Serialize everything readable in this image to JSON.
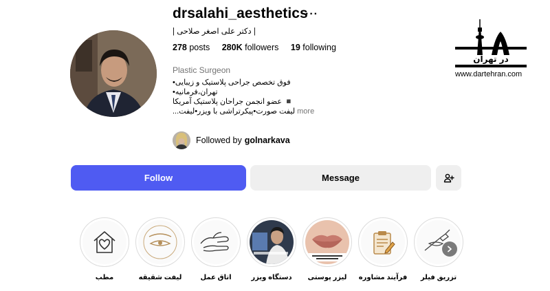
{
  "profile": {
    "username": "drsalahi_aesthetics",
    "more_icon": "more-horizontal-icon",
    "full_name": "| دکتر علی اصغر صلاحی |",
    "posts_count": "278",
    "posts_label": "posts",
    "followers_count": "280K",
    "followers_label": "followers",
    "following_count": "19",
    "following_label": "following",
    "category": "Plastic Surgeon",
    "bio_lines": [
      "فوق تخصص جراحی پلاستیک و زیبایی•",
      "تهران،فرمانیه•",
      "◾️ عضو انجمن جراحان پلاستیک آمریکا",
      "لیفت صورت•پیکرتراشی با ویزر•لیفت..."
    ],
    "bio_more": "more",
    "followed_by_prefix": "Followed by",
    "followed_by_user": "golnarkava"
  },
  "actions": {
    "follow": "Follow",
    "message": "Message",
    "add_user_icon": "add-user-icon"
  },
  "watermark": {
    "logo_text": "در تهران",
    "url": "www.dartehran.com"
  },
  "highlights": [
    {
      "label": "مطب",
      "icon": "house-heart-icon"
    },
    {
      "label": "لیفت شقیقه",
      "icon": "eye-line-icon"
    },
    {
      "label": "اتاق عمل",
      "icon": "hand-sketch-icon"
    },
    {
      "label": "دستگاه ویزر",
      "icon": "photo-thumbnail"
    },
    {
      "label": "لیزر پوستی",
      "icon": "lips-photo"
    },
    {
      "label": "فرآیند مشاوره",
      "icon": "clipboard-icon"
    },
    {
      "label": "تزریق فیلر",
      "icon": "syringe-sketch-icon"
    }
  ],
  "colors": {
    "follow_button": "#4f5bf2",
    "secondary_button": "#efefef",
    "muted_text": "#737373"
  }
}
